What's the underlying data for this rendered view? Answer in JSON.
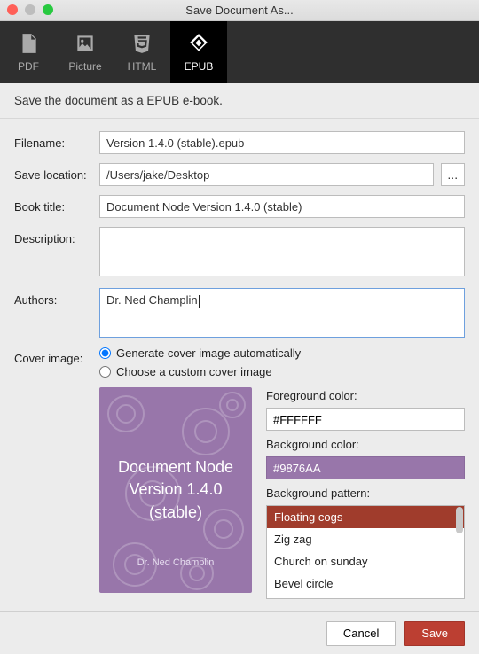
{
  "window": {
    "title": "Save Document As..."
  },
  "tabs": {
    "pdf": "PDF",
    "picture": "Picture",
    "html": "HTML",
    "epub": "EPUB"
  },
  "description": "Save the document as a EPUB e-book.",
  "labels": {
    "filename": "Filename:",
    "save_location": "Save location:",
    "book_title": "Book title:",
    "description": "Description:",
    "authors": "Authors:",
    "cover_image": "Cover image:",
    "foreground": "Foreground color:",
    "background": "Background color:",
    "pattern": "Background pattern:"
  },
  "values": {
    "filename": "Version 1.4.0 (stable).epub",
    "save_location": "/Users/jake/Desktop",
    "book_title": "Document Node Version 1.4.0 (stable)",
    "description": "",
    "authors": "Dr. Ned Champlin",
    "browse": "...",
    "fg_color": "#FFFFFF",
    "bg_color": "#9876AA"
  },
  "radios": {
    "auto": "Generate cover image automatically",
    "custom": "Choose a custom cover image"
  },
  "cover": {
    "line1": "Document Node",
    "line2": "Version 1.4.0",
    "line3": "(stable)",
    "author": "Dr. Ned Champlin"
  },
  "patterns": [
    "Floating cogs",
    "Zig zag",
    "Church on sunday",
    "Bevel circle"
  ],
  "buttons": {
    "cancel": "Cancel",
    "save": "Save"
  }
}
